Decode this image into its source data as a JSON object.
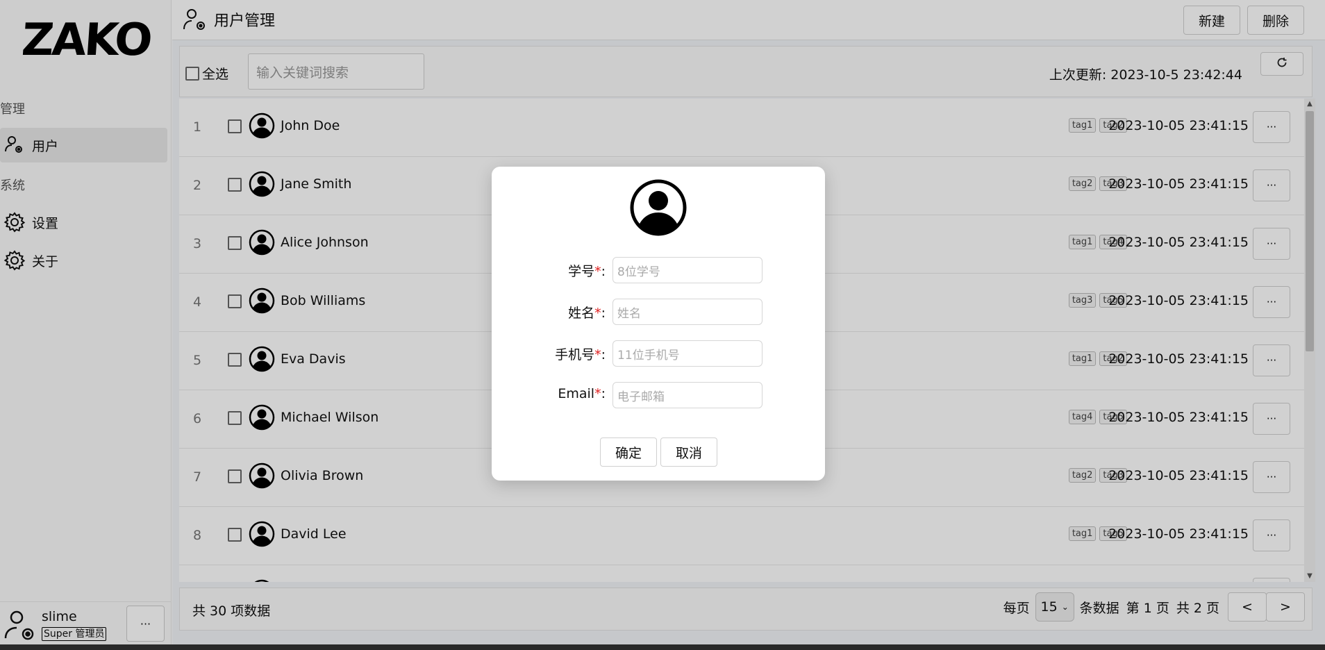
{
  "app": {
    "logo_text": "ZAKO",
    "page_title": "用户管理"
  },
  "sidebar": {
    "sections": [
      {
        "label": "管理"
      },
      {
        "label": "系统"
      }
    ],
    "items": [
      {
        "label": "用户",
        "icon": "user-gear-icon",
        "active": true
      },
      {
        "label": "设置",
        "icon": "gear-icon",
        "active": false
      },
      {
        "label": "关于",
        "icon": "gear-icon",
        "active": false
      }
    ],
    "user": {
      "name": "slime",
      "role_badge": "Super 管理员",
      "more_label": "···"
    }
  },
  "header": {
    "new_label": "新建",
    "delete_label": "删除"
  },
  "toolbar": {
    "select_all_label": "全选",
    "search_placeholder": "输入关键词搜索",
    "last_updated": "上次更新: 2023-10-5 23:42:44",
    "refresh_icon": "refresh-icon"
  },
  "rows": [
    {
      "index": "1",
      "name": "John Doe",
      "tags": [
        "tag1",
        "tag2"
      ],
      "time": "2023-10-05 23:41:15"
    },
    {
      "index": "2",
      "name": "Jane Smith",
      "tags": [
        "tag2",
        "tag3"
      ],
      "time": "2023-10-05 23:41:15"
    },
    {
      "index": "3",
      "name": "Alice Johnson",
      "tags": [
        "tag1",
        "tag4"
      ],
      "time": "2023-10-05 23:41:15"
    },
    {
      "index": "4",
      "name": "Bob Williams",
      "tags": [
        "tag3",
        "tag5"
      ],
      "time": "2023-10-05 23:41:15"
    },
    {
      "index": "5",
      "name": "Eva Davis",
      "tags": [
        "tag1",
        "tag2"
      ],
      "time": "2023-10-05 23:41:15"
    },
    {
      "index": "6",
      "name": "Michael Wilson",
      "tags": [
        "tag4",
        "tag5"
      ],
      "time": "2023-10-05 23:41:15"
    },
    {
      "index": "7",
      "name": "Olivia Brown",
      "tags": [
        "tag2",
        "tag3"
      ],
      "time": "2023-10-05 23:41:15"
    },
    {
      "index": "8",
      "name": "David Lee",
      "tags": [
        "tag1",
        "tag5"
      ],
      "time": "2023-10-05 23:41:15"
    }
  ],
  "row_more_label": "···",
  "footer": {
    "total": "共 30 项数据",
    "per_page_prefix": "每页",
    "per_page_value": "15",
    "per_page_suffix": "条数据",
    "current_page": "第 1 页",
    "total_pages": "共 2 页",
    "prev_label": "<",
    "next_label": ">"
  },
  "modal": {
    "fields": [
      {
        "label": "学号",
        "placeholder": "8位学号"
      },
      {
        "label": "姓名",
        "placeholder": "姓名"
      },
      {
        "label": "手机号",
        "placeholder": "11位手机号"
      },
      {
        "label": "Email",
        "placeholder": "电子邮箱"
      }
    ],
    "required_mark": "*",
    "colon": ":",
    "confirm_label": "确定",
    "cancel_label": "取消"
  },
  "colors": {
    "required": "#e02020",
    "overlay": "rgba(0,0,0,0.18)"
  }
}
